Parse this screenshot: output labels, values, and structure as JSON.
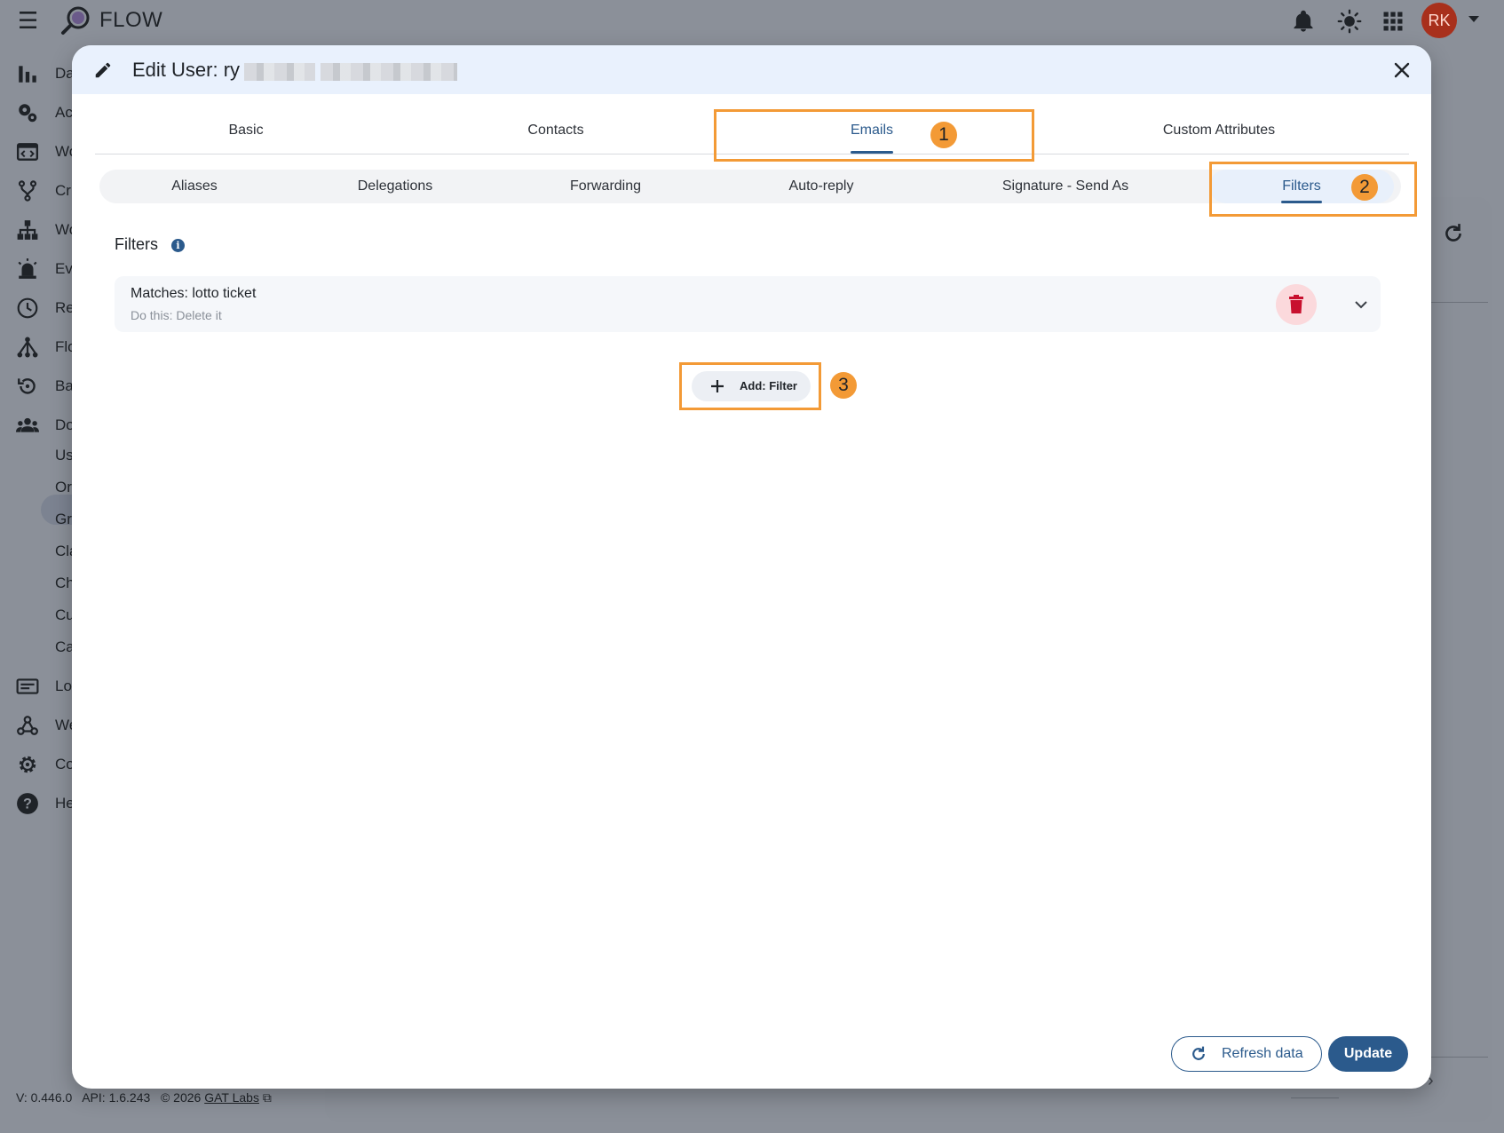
{
  "app": {
    "title": "FLOW",
    "avatar_initials": "RK"
  },
  "sidebar": {
    "items": [
      {
        "label": "Da",
        "icon": "bar-chart-icon"
      },
      {
        "label": "Ac",
        "icon": "gears-icon"
      },
      {
        "label": "Wo",
        "icon": "code-window-icon"
      },
      {
        "label": "Cr",
        "icon": "fork-icon"
      },
      {
        "label": "Wo",
        "icon": "org-tree-icon"
      },
      {
        "label": "Ev",
        "icon": "alarm-icon"
      },
      {
        "label": "Re",
        "icon": "clock-icon"
      },
      {
        "label": "Flo",
        "icon": "flow-icon"
      },
      {
        "label": "Ba",
        "icon": "backup-icon"
      },
      {
        "label": "Do",
        "icon": "people-icon"
      }
    ],
    "sub_items": [
      "Us",
      "Or",
      "Gr",
      "Cla",
      "Ch",
      "Cu",
      "Ca"
    ],
    "bottom_items": [
      {
        "label": "Lo",
        "icon": "log-icon"
      },
      {
        "label": "We",
        "icon": "webhook-icon"
      },
      {
        "label": "Co",
        "icon": "settings-icon"
      },
      {
        "label": "He",
        "icon": "help-icon"
      }
    ]
  },
  "footer": {
    "version": "V: 0.446.0",
    "api": "API: 1.6.243",
    "copyright": "© 2026",
    "company_link": "GAT Labs"
  },
  "dialog": {
    "title": "Edit User: ry",
    "main_tabs": [
      "Basic",
      "Contacts",
      "Emails",
      "Custom Attributes"
    ],
    "active_main_tab": "Emails",
    "sub_tabs": [
      "Aliases",
      "Delegations",
      "Forwarding",
      "Auto-reply",
      "Signature - Send As",
      "Filters"
    ],
    "active_sub_tab": "Filters",
    "section_title": "Filters",
    "filters": [
      {
        "title": "Matches: lotto ticket",
        "action": "Do this: Delete it"
      }
    ],
    "add_button": "Add: Filter",
    "refresh_button": "Refresh data",
    "update_button": "Update"
  },
  "annotations": [
    "1",
    "2",
    "3"
  ],
  "colors": {
    "accent": "#2b5a8c",
    "annotation": "#f39a36",
    "delete_bg": "#fbd9dc",
    "delete_icon": "#c8102e",
    "avatar": "#a8301c"
  }
}
